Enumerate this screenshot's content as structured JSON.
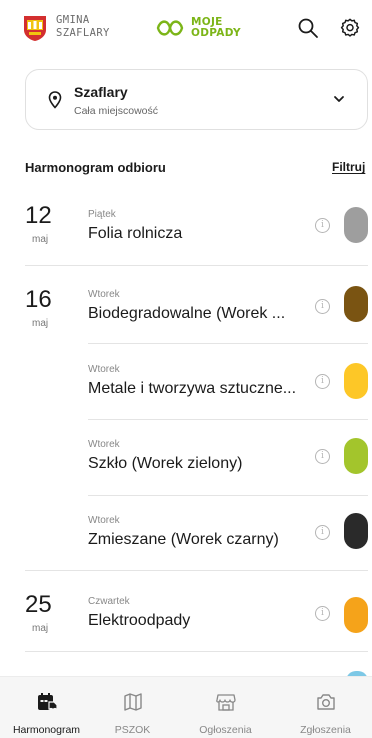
{
  "header": {
    "gmina_line1": "GMINA",
    "gmina_line2": "SZAFLARY",
    "brand_line1": "MOJE",
    "brand_line2": "ODPADY",
    "brand_color": "#7cb518",
    "search_icon": "search-icon",
    "settings_icon": "gear-icon"
  },
  "location": {
    "name": "Szaflary",
    "subtitle": "Cała miejscowość",
    "pin_icon": "location-pin-icon",
    "chevron_icon": "chevron-down-icon"
  },
  "schedule": {
    "title": "Harmonogram odbioru",
    "filter_label": "Filtruj",
    "entries": [
      {
        "day": "12",
        "month": "maj",
        "weekday": "Piątek",
        "waste": "Folia rolnicza",
        "color": "#9e9e9e"
      },
      {
        "day": "16",
        "month": "maj",
        "weekday": "Wtorek",
        "waste": "Biodegradowalne (Worek ...",
        "color": "#7a5412"
      },
      {
        "day": "",
        "month": "",
        "weekday": "Wtorek",
        "waste": "Metale i tworzywa sztuczne...",
        "color": "#fdc727"
      },
      {
        "day": "",
        "month": "",
        "weekday": "Wtorek",
        "waste": "Szkło (Worek zielony)",
        "color": "#a3c52c"
      },
      {
        "day": "",
        "month": "",
        "weekday": "Wtorek",
        "waste": "Zmieszane (Worek czarny)",
        "color": "#2a2a2a"
      },
      {
        "day": "25",
        "month": "maj",
        "weekday": "Czwartek",
        "waste": "Elektroodpady",
        "color": "#f5a31a"
      }
    ]
  },
  "nav": {
    "items": [
      {
        "label": "Harmonogram",
        "icon": "calendar-truck-icon",
        "active": true
      },
      {
        "label": "PSZOK",
        "icon": "map-icon",
        "active": false
      },
      {
        "label": "Ogłoszenia",
        "icon": "store-icon",
        "active": false
      },
      {
        "label": "Zgłoszenia",
        "icon": "camera-icon",
        "active": false
      }
    ]
  }
}
